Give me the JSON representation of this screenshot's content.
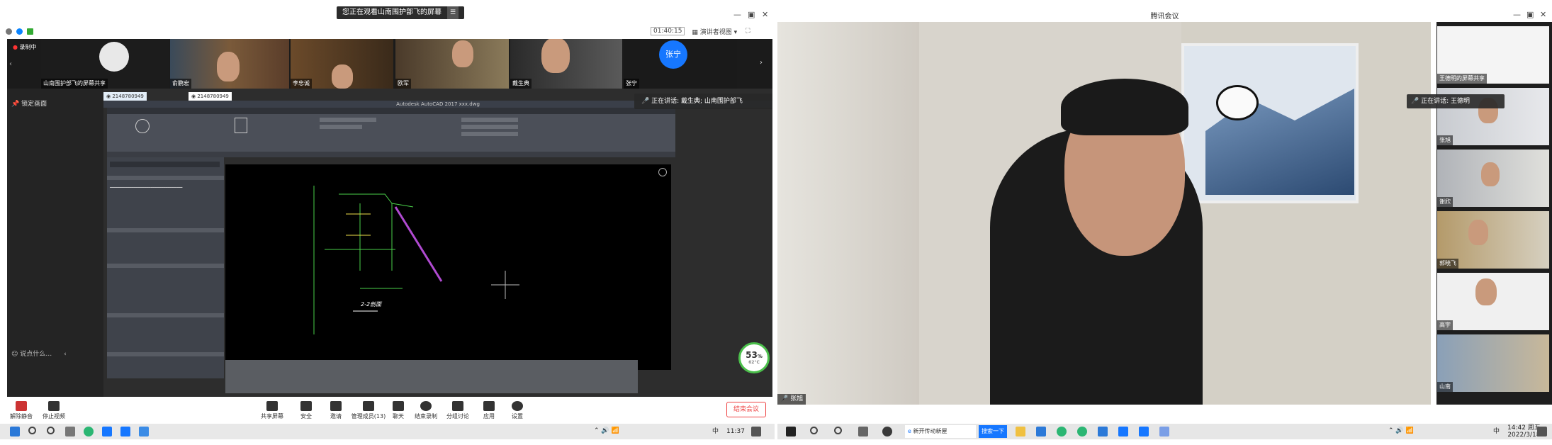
{
  "left": {
    "notice": "您正在观看山南围护部飞的屏幕",
    "notice_btn": "☰",
    "timer": "01:40:15",
    "view_mode": "演讲者视图",
    "recording": "录制中",
    "tiles": [
      "山南围护部飞的屏幕共享",
      "俞鹏宏",
      "李忠诚",
      "欧军",
      "戴生典",
      "张宁"
    ],
    "avatar_name": "张宁",
    "pin": "锁定画面",
    "talk": "说点什么…",
    "speaking": "正在讲话: 戴生典; 山南围护部飞",
    "browser_tab1": "2148780949",
    "browser_tab2": "2148780949",
    "acad_title": "Autodesk AutoCAD 2017  xxx.dwg",
    "drawing_label": "2-2剖面",
    "perf": "53",
    "perf_unit": "%",
    "temp": "62°C",
    "toolbar": [
      {
        "key": "mute",
        "label": "解除静音"
      },
      {
        "key": "video",
        "label": "停止视频"
      },
      {
        "key": "share",
        "label": "共享屏幕"
      },
      {
        "key": "security",
        "label": "安全"
      },
      {
        "key": "invite",
        "label": "邀请"
      },
      {
        "key": "members",
        "label": "管理成员(13)"
      },
      {
        "key": "chat",
        "label": "聊天"
      },
      {
        "key": "record",
        "label": "结束录制"
      },
      {
        "key": "breakout",
        "label": "分组讨论"
      },
      {
        "key": "apps",
        "label": "应用"
      },
      {
        "key": "settings",
        "label": "设置"
      }
    ],
    "end_meeting": "结束会议",
    "time": "11:37",
    "ime": "中"
  },
  "right": {
    "title": "腾讯会议",
    "speaking": "正在讲话: 王德明",
    "main_name": "张旭",
    "thumbs": [
      "王德明的屏幕共享",
      "张旭",
      "谢欣",
      "郭晓飞",
      "高宇",
      "山南"
    ],
    "search_text": "新开传动新屋",
    "search_btn": "搜索一下",
    "time": "14:42 周五",
    "date": "2022/3/18",
    "ime": "中"
  },
  "colors": {
    "accent": "#0a84ff",
    "end_red": "#e44444",
    "cad_green": "#4ad14a"
  }
}
